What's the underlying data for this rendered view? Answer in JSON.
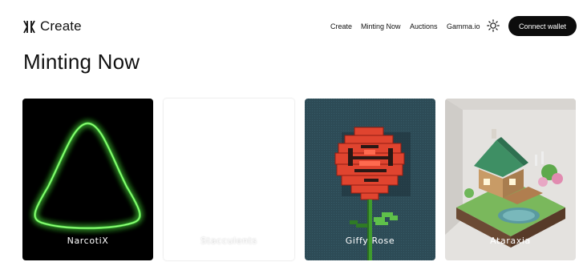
{
  "brand": {
    "name": "Create"
  },
  "nav": {
    "links": [
      "Create",
      "Minting Now",
      "Auctions",
      "Gamma.io"
    ],
    "theme_icon": "sun-icon",
    "connect_label": "Connect wallet"
  },
  "page": {
    "title": "Minting Now"
  },
  "collections": [
    {
      "name": "NarcotiX"
    },
    {
      "name": "Stacculents"
    },
    {
      "name": "Giffy Rose"
    },
    {
      "name": "Ataraxia"
    }
  ],
  "colors": {
    "connect_bg": "#0c0c0c",
    "narcotix_bg": "#000000",
    "narcotix_glow": "#46d23a",
    "giffy_bg": "#2c4a55",
    "rose_red": "#e0442f",
    "ataraxia_bg": "#e4e2df"
  }
}
